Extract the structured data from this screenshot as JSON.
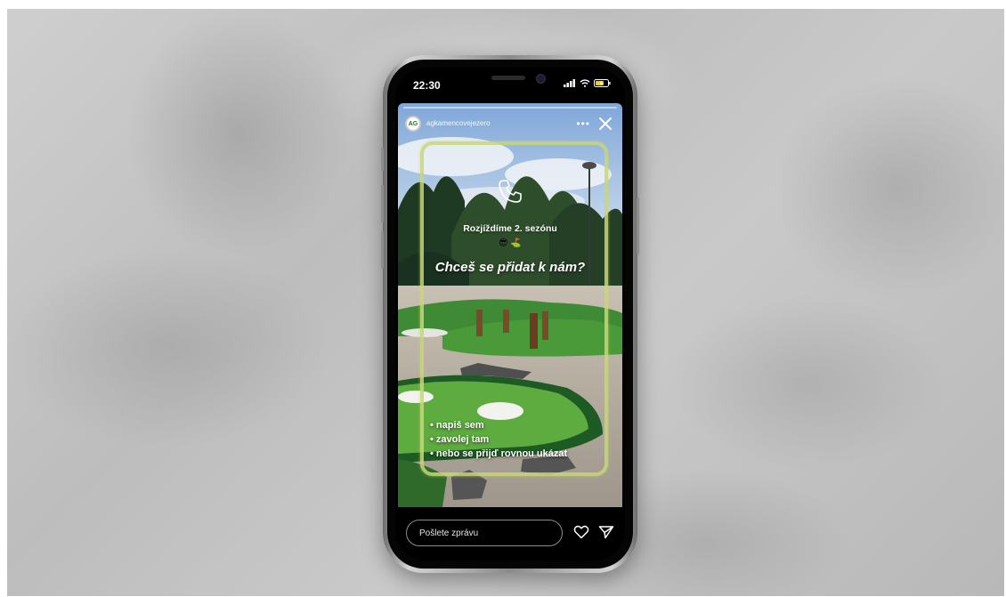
{
  "status_bar": {
    "time": "22:30"
  },
  "story": {
    "username": "agkamencovejezero",
    "avatar_initials": "AG",
    "more_label": "•••",
    "subtitle": "Rozjíždíme 2. sezónu",
    "emoji": "😎 ⛳",
    "headline": "Chceš se přidat k nám?",
    "bullets": [
      "• napiš sem",
      "• zavolej tam",
      "• nebo se přijď rovnou ukázat"
    ]
  },
  "message_bar": {
    "placeholder": "Pošlete zprávu"
  },
  "icons": {
    "phone": "phone-icon",
    "close": "close-icon",
    "heart": "heart-icon",
    "send": "send-icon",
    "signal": "signal-icon",
    "wifi": "wifi-icon",
    "battery": "battery-icon"
  },
  "colors": {
    "frame_accent": "#c8d678"
  }
}
